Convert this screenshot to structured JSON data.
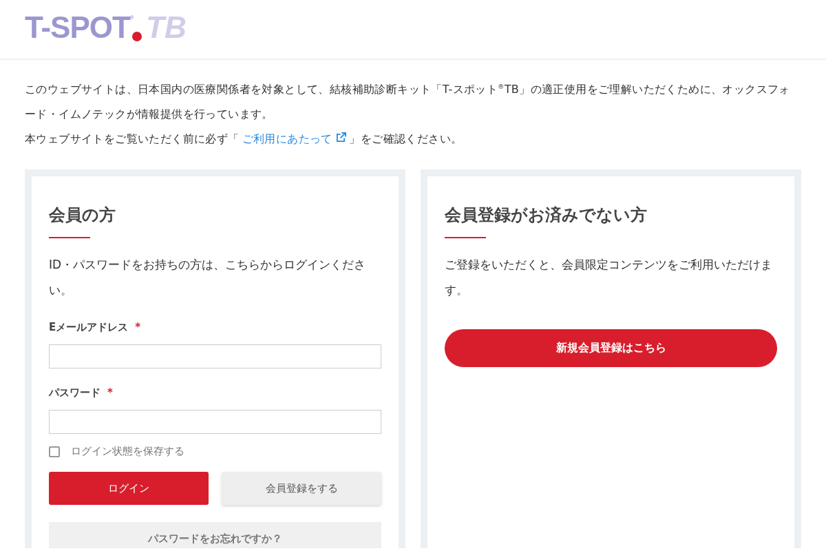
{
  "header": {
    "logo": {
      "brand": "T-SPOT",
      "mark": "®",
      "suffix": "TB"
    }
  },
  "intro": {
    "paragraph": "このウェブサイトは、日本国内の医療関係者を対象として、結核補助診断キット「T-スポット$^{®}$TB」の適正使用をご理解いただくために、オックスフォード・イムノテックが情報提供を行っています。",
    "notice_before": "本ウェブサイトをご覧いただく前に必ず「",
    "notice_link": "ご利用にあたって",
    "notice_after": "」をご確認ください。"
  },
  "login": {
    "title": "会員の方",
    "description": "ID・パスワードをお持ちの方は、こちらからログインください。",
    "fields": [
      {
        "label": "Eメールアドレス",
        "required_mark": "*"
      },
      {
        "label": "パスワード",
        "required_mark": "*"
      }
    ],
    "remember": {
      "label": "ログイン状態を保存する",
      "checked": false
    },
    "login_button": "ログイン",
    "register_button": "会員登録をする",
    "forgot_button": "パスワードをお忘れですか？"
  },
  "signup": {
    "title": "会員登録がお済みでない方",
    "description": "ご登録をいただくと、会員限定コンテンツをご利用いただけます。",
    "button": "新規会員登録はこちら"
  }
}
